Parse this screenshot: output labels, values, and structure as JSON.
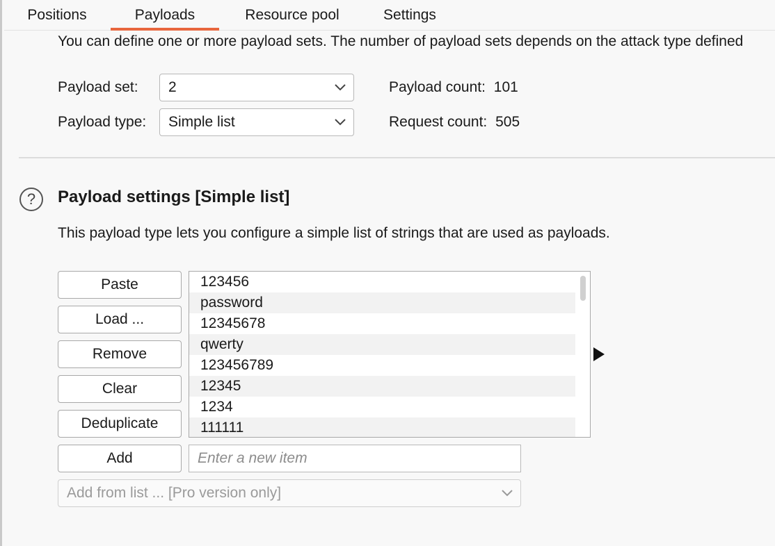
{
  "tabs": [
    {
      "label": "Positions"
    },
    {
      "label": "Payloads"
    },
    {
      "label": "Resource pool"
    },
    {
      "label": "Settings"
    }
  ],
  "description": "You can define one or more payload sets. The number of payload sets depends on the attack type defined",
  "payload_set": {
    "label": "Payload set:",
    "value": "2"
  },
  "payload_type": {
    "label": "Payload type:",
    "value": "Simple list"
  },
  "payload_count": {
    "label": "Payload count:",
    "value": "101"
  },
  "request_count": {
    "label": "Request count:",
    "value": "505"
  },
  "section": {
    "help_icon": "?",
    "title": "Payload settings [Simple list]",
    "description": "This payload type lets you configure a simple list of strings that are used as payloads."
  },
  "buttons": {
    "paste": "Paste",
    "load": "Load ...",
    "remove": "Remove",
    "clear": "Clear",
    "deduplicate": "Deduplicate",
    "add": "Add"
  },
  "payload_list": [
    "123456",
    "password",
    "12345678",
    "qwerty",
    "123456789",
    "12345",
    "1234",
    "111111"
  ],
  "new_item": {
    "placeholder": "Enter a new item",
    "value": ""
  },
  "add_from_list": {
    "value": "Add from list ... [Pro version only]"
  },
  "colors": {
    "accent": "#e8663d"
  },
  "icons": {
    "dropdown": "chevron-down-icon",
    "expand": "triangle-right-icon",
    "help": "help-circle-icon"
  }
}
